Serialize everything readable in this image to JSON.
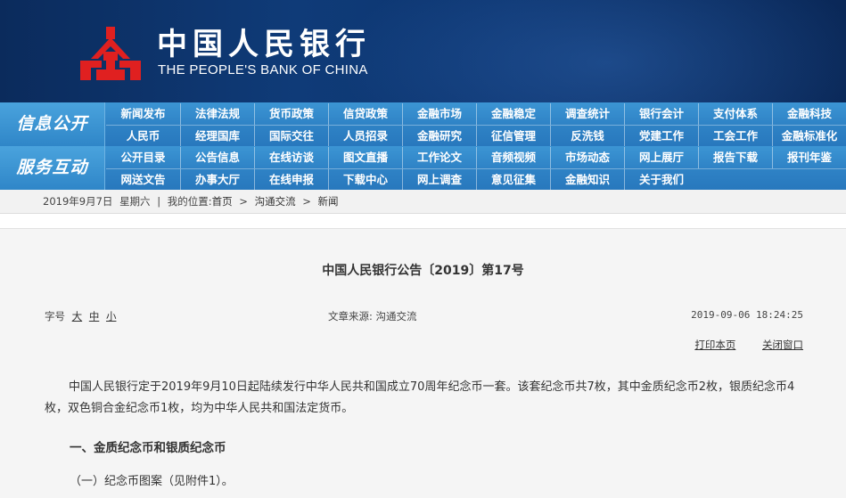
{
  "header": {
    "bank_name_cn": "中国人民银行",
    "bank_name_en": "THE PEOPLE'S BANK OF CHINA",
    "logo_icon": "pboc-logo-icon",
    "colors": {
      "banner": "#0f3b78",
      "nav": "#2f83c6",
      "logo": "#e02020"
    }
  },
  "nav": {
    "section1_label": "信息公开",
    "section2_label": "服务互动",
    "row1": [
      "新闻发布",
      "法律法规",
      "货币政策",
      "信贷政策",
      "金融市场",
      "金融稳定",
      "调查统计",
      "银行会计",
      "支付体系",
      "金融科技"
    ],
    "row2": [
      "人民币",
      "经理国库",
      "国际交往",
      "人员招录",
      "金融研究",
      "征信管理",
      "反洗钱",
      "党建工作",
      "工会工作",
      "金融标准化"
    ],
    "row3": [
      "公开目录",
      "公告信息",
      "在线访谈",
      "图文直播",
      "工作论文",
      "音频视频",
      "市场动态",
      "网上展厅",
      "报告下载",
      "报刊年鉴"
    ],
    "row4": [
      "网送文告",
      "办事大厅",
      "在线申报",
      "下载中心",
      "网上调查",
      "意见征集",
      "金融知识",
      "关于我们"
    ]
  },
  "breadcrumb": {
    "date": "2019年9月7日",
    "weekday": "星期六",
    "sep": "|",
    "location_label": "我的位置:",
    "home": "首页",
    "arrow": ">",
    "level1": "沟通交流",
    "level2": "新闻"
  },
  "article": {
    "title": "中国人民银行公告〔2019〕第17号",
    "font_size_label": "字号",
    "size_large": "大",
    "size_medium": "中",
    "size_small": "小",
    "source": "文章来源: 沟通交流",
    "datetime": "2019-09-06 18:24:25",
    "print_label": "打印本页",
    "close_label": "关闭窗口",
    "paragraph1": "中国人民银行定于2019年9月10日起陆续发行中华人民共和国成立70周年纪念币一套。该套纪念币共7枚，其中金质纪念币2枚，银质纪念币4枚，双色铜合金纪念币1枚，均为中华人民共和国法定货币。",
    "heading1": "一、金质纪念币和银质纪念币",
    "heading2": "（一）纪念币图案（见附件1）。"
  }
}
